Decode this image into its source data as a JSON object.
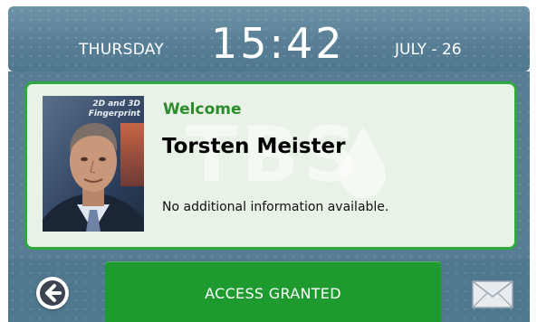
{
  "header": {
    "day": "THURSDAY",
    "time": "15:42",
    "date": "JULY - 26"
  },
  "card": {
    "welcome": "Welcome",
    "name": "Torsten Meister",
    "info": "No additional information available.",
    "watermark": "TBS",
    "photo_caption": "2D and 3D\nFingerprint",
    "accent_color": "#2fa83e"
  },
  "footer": {
    "back_icon": "arrow-left-icon",
    "access_label": "ACCESS GRANTED",
    "access_color": "#1f9a2f",
    "mail_icon": "envelope-icon"
  }
}
